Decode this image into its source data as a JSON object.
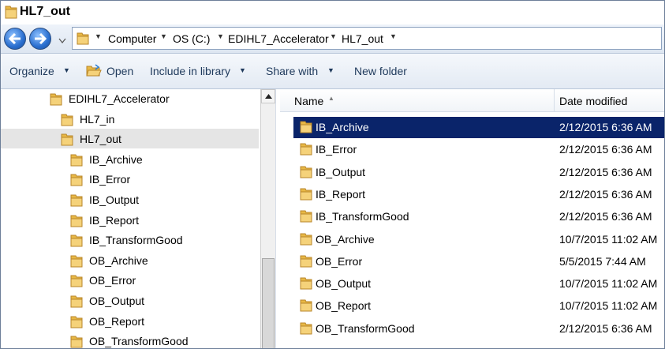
{
  "window": {
    "title": "HL7_out"
  },
  "address_bar": {
    "crumbs": [
      "Computer",
      "OS (C:)",
      "EDIHL7_Accelerator",
      "HL7_out"
    ]
  },
  "toolbar": {
    "organize_label": "Organize",
    "open_label": "Open",
    "include_label": "Include in library",
    "share_label": "Share with",
    "newfolder_label": "New folder"
  },
  "tree": {
    "items": [
      {
        "label": "EDIHL7_Accelerator"
      },
      {
        "label": "HL7_in"
      },
      {
        "label": "HL7_out"
      },
      {
        "label": "IB_Archive"
      },
      {
        "label": "IB_Error"
      },
      {
        "label": "IB_Output"
      },
      {
        "label": "IB_Report"
      },
      {
        "label": "IB_TransformGood"
      },
      {
        "label": "OB_Archive"
      },
      {
        "label": "OB_Error"
      },
      {
        "label": "OB_Output"
      },
      {
        "label": "OB_Report"
      },
      {
        "label": "OB_TransformGood"
      }
    ],
    "selected": "HL7_out"
  },
  "list": {
    "columns": {
      "name": "Name",
      "date": "Date modified"
    },
    "rows": [
      {
        "name": "IB_Archive",
        "date": "2/12/2015 6:36 AM",
        "selected": true
      },
      {
        "name": "IB_Error",
        "date": "2/12/2015 6:36 AM"
      },
      {
        "name": "IB_Output",
        "date": "2/12/2015 6:36 AM"
      },
      {
        "name": "IB_Report",
        "date": "2/12/2015 6:36 AM"
      },
      {
        "name": "IB_TransformGood",
        "date": "2/12/2015 6:36 AM"
      },
      {
        "name": "OB_Archive",
        "date": "10/7/2015 11:02 AM"
      },
      {
        "name": "OB_Error",
        "date": "5/5/2015 7:44 AM"
      },
      {
        "name": "OB_Output",
        "date": "10/7/2015 11:02 AM"
      },
      {
        "name": "OB_Report",
        "date": "10/7/2015 11:02 AM"
      },
      {
        "name": "OB_TransformGood",
        "date": "2/12/2015 6:36 AM"
      }
    ]
  },
  "icons": {
    "folder": "folder-icon",
    "back": "back-arrow-icon",
    "forward": "forward-arrow-icon",
    "open": "open-icon"
  },
  "colors": {
    "selection": "#0a246a",
    "tree_selection": "#e5e5e5",
    "folder": "#e8b845"
  }
}
